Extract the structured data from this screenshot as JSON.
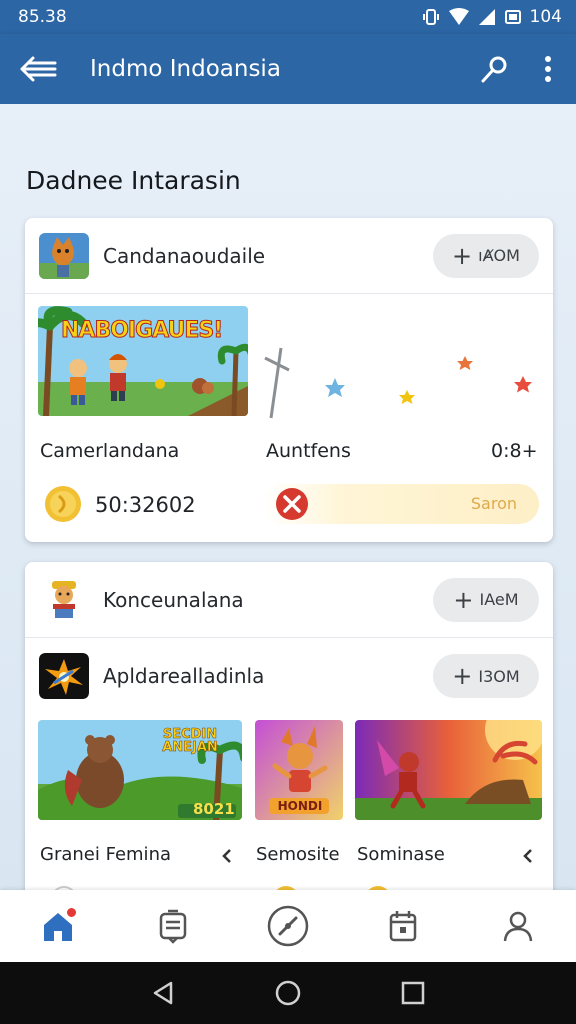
{
  "status": {
    "time": "85.38",
    "battery": "104"
  },
  "app_bar": {
    "title": "Indmo Indoansia"
  },
  "section": {
    "title": "Dadnee Intarasin"
  },
  "card1": {
    "app_name": "Candanaoudaile",
    "button_label": "ıȺOM",
    "banner_text": "NABOIGAUES!",
    "row1": {
      "left": "Camerlandana",
      "middle": "Auntfens",
      "right": "0:8+"
    },
    "row2": {
      "value": "50:32602",
      "progress_label": "Saron",
      "progress": 1.0
    }
  },
  "card2": {
    "app1_name": "Konceunalana",
    "app1_button": "IAeM",
    "app2_name": "Apldarealladinla",
    "app2_button": "I3OM",
    "thumb1_text": "SECDIN ANEJAN",
    "thumb1_counter": "8021",
    "thumb2_text": "HONDI",
    "captions": {
      "first": "Granei Femina",
      "second": "Semosite",
      "third": "Sominase"
    }
  },
  "colors": {
    "primary": "#2c66a4",
    "accent_red": "#e53935",
    "gold": "#f2c033"
  },
  "icons": {
    "back": "back-arrow-icon",
    "search": "search-icon",
    "more": "more-vert-icon",
    "nav": [
      "home-icon",
      "inbox-icon",
      "compass-icon",
      "calendar-icon",
      "profile-icon"
    ]
  }
}
